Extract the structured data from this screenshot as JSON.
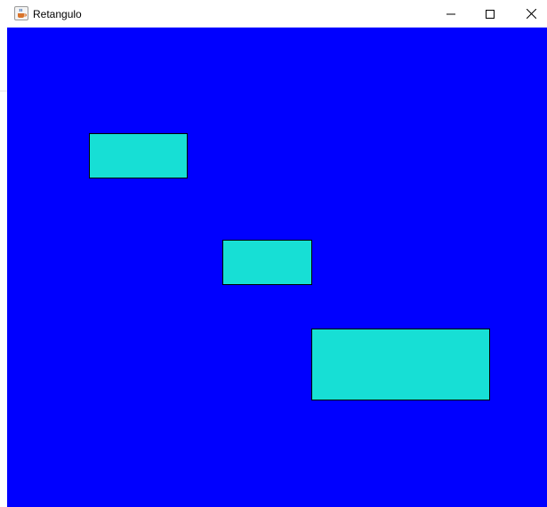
{
  "window": {
    "title": "Retangulo",
    "icon": "java-cup-icon",
    "controls": [
      "minimize-icon",
      "maximize-icon",
      "close-icon"
    ]
  },
  "canvas": {
    "background_color": "#0000ff",
    "rectangle_fill": "#17dfd5",
    "rectangle_border": "#000000",
    "rectangle_count": 3
  }
}
